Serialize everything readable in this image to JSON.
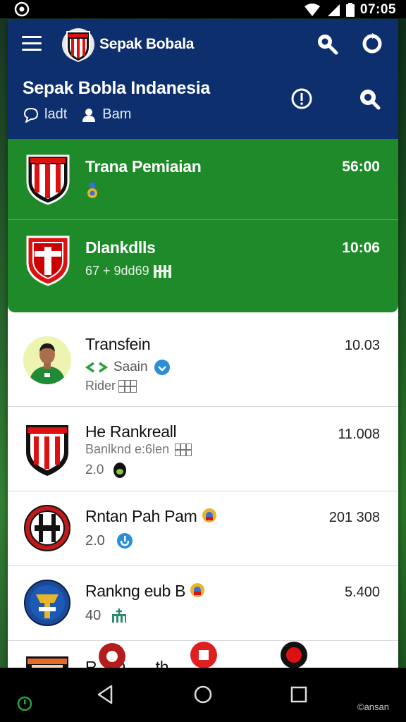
{
  "status_bar": {
    "time": "07:05",
    "icons": [
      "app-indicator-icon",
      "wifi-icon",
      "signal-icon",
      "battery-icon"
    ]
  },
  "header": {
    "app_title": "Sepak Bobala",
    "page_title": "Sepak Bobla Indanesia",
    "filter_1": "ladt",
    "filter_2": "Bam",
    "colors": {
      "background": "#0d2f6e",
      "text": "#ffffff"
    }
  },
  "featured": {
    "background": "#1e8a2a",
    "items": [
      {
        "title": "Trana Pemiaian",
        "time": "56:00",
        "meta": ""
      },
      {
        "title": "Dlankdlls",
        "time": "10:06",
        "meta": "67 + 9dd69"
      }
    ]
  },
  "list": {
    "items": [
      {
        "title": "Transfein",
        "time": "10.03",
        "meta": "Saain",
        "meta2": "Rider"
      },
      {
        "title": "He Rankreall",
        "time": "11.008",
        "meta": "Banlknd e:6len",
        "meta2": "2.0"
      },
      {
        "title": "Rntan Pah Pam",
        "time": "201 308",
        "meta": "2.0",
        "meta2": ""
      },
      {
        "title": "Rankng eub B",
        "time": "5.400",
        "meta": "40",
        "meta2": ""
      },
      {
        "title": "R... D... ...th",
        "time": "",
        "meta": "",
        "meta2": ""
      }
    ]
  },
  "nav": {
    "right_label": "©ansan"
  }
}
